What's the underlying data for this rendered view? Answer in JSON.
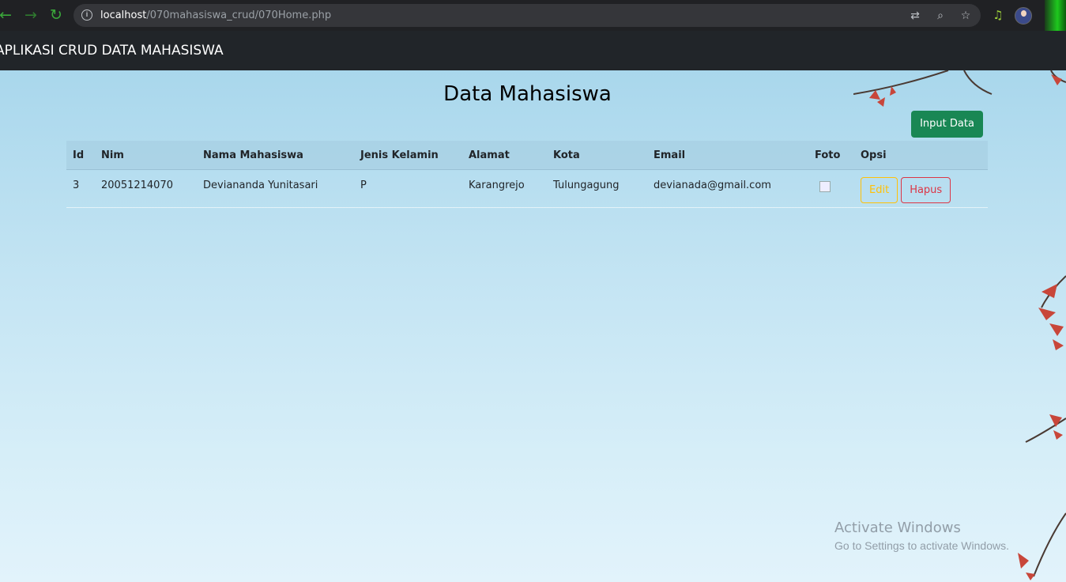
{
  "browser": {
    "url_host": "localhost",
    "url_path": "/070mahasiswa_crud/070Home.php",
    "back_icon": "←",
    "forward_icon": "→",
    "reload_icon": "↻",
    "translate_icon": "⇄",
    "zoom_icon": "⌕",
    "star_icon": "☆",
    "media_icon": "♫",
    "menu_icon": "⋮"
  },
  "navbar": {
    "brand": "APLIKASI CRUD DATA MAHASISWA"
  },
  "main": {
    "title": "Data Mahasiswa",
    "input_button": "Input Data",
    "table": {
      "headers": [
        "Id",
        "Nim",
        "Nama Mahasiswa",
        "Jenis Kelamin",
        "Alamat",
        "Kota",
        "Email",
        "Foto",
        "Opsi"
      ],
      "rows": [
        {
          "id": "3",
          "nim": "20051214070",
          "nama": "Deviananda Yunitasari",
          "jk": "P",
          "alamat": "Karangrejo",
          "kota": "Tulungagung",
          "email": "devianada@gmail.com",
          "edit": "Edit",
          "hapus": "Hapus"
        }
      ]
    }
  },
  "watermark": {
    "title": "Activate Windows",
    "subtitle": "Go to Settings to activate Windows."
  },
  "colors": {
    "navbar": "#212529",
    "success": "#198754",
    "warning": "#ffc107",
    "danger": "#dc3545"
  }
}
